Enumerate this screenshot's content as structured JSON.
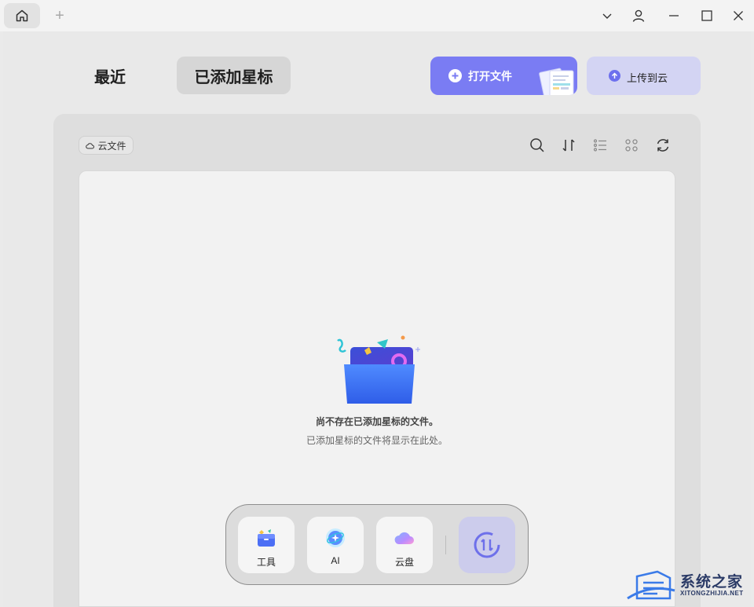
{
  "titlebar": {
    "home_icon": "home-icon",
    "new_tab_icon": "plus-icon",
    "new_tab_label": "+"
  },
  "tabs": {
    "recent": "最近",
    "starred": "已添加星标"
  },
  "actions": {
    "open_file": "打开文件",
    "upload_cloud": "上传到云"
  },
  "toolbar": {
    "cloud_chip": "云文件"
  },
  "empty_state": {
    "title": "尚不存在已添加星标的文件。",
    "subtitle": "已添加星标的文件将显示在此处。"
  },
  "dock": {
    "tools": "工具",
    "ai": "AI",
    "cloud_disk": "云盘"
  },
  "watermark": {
    "text": "系统之家",
    "sub": "XITONGZHIJIA.NET"
  },
  "colors": {
    "accent": "#7a7cf3",
    "accent_light": "#d3d4f3"
  }
}
